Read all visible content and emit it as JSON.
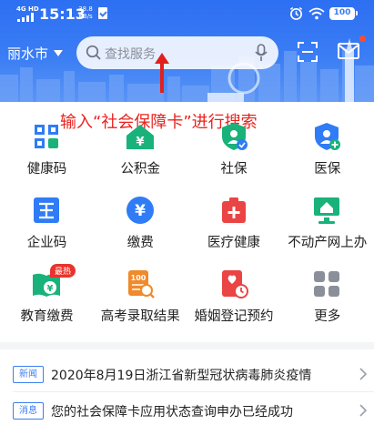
{
  "status_bar": {
    "signal": "4G HD",
    "time": "15:13",
    "net_speed_value": "38.8",
    "net_speed_unit": "KB/s",
    "battery": "100"
  },
  "header": {
    "city": "丽水市",
    "search_placeholder": "查找服务",
    "has_notification_dot": true
  },
  "annotation": "输入“社会保障卡”进行搜索",
  "services": [
    {
      "label": "健康码",
      "icon": "health-code-icon",
      "color": "#2f7cf6"
    },
    {
      "label": "公积金",
      "icon": "housing-fund-icon",
      "color": "#19b27a"
    },
    {
      "label": "社保",
      "icon": "social-security-icon",
      "color": "#19b27a"
    },
    {
      "label": "医保",
      "icon": "medical-insurance-icon",
      "color": "#2f7cf6"
    },
    {
      "label": "企业码",
      "icon": "enterprise-code-icon",
      "color": "#2f7cf6"
    },
    {
      "label": "缴费",
      "icon": "payment-icon",
      "color": "#2f7cf6"
    },
    {
      "label": "医疗健康",
      "icon": "medical-health-icon",
      "color": "#ea4444"
    },
    {
      "label": "不动产网上办",
      "icon": "real-estate-icon",
      "color": "#19b27a"
    },
    {
      "label": "教育缴费",
      "icon": "education-payment-icon",
      "color": "#19b27a",
      "badge": "最热"
    },
    {
      "label": "高考录取结果",
      "icon": "exam-result-icon",
      "color": "#f08a2c"
    },
    {
      "label": "婚姻登记预约",
      "icon": "marriage-registration-icon",
      "color": "#ea4444"
    },
    {
      "label": "更多",
      "icon": "more-grid-icon",
      "color": "#8a8f9a"
    }
  ],
  "news": [
    {
      "tag": "新闻",
      "text": "2020年8月19日浙江省新型冠状病毒肺炎疫情"
    },
    {
      "tag": "消息",
      "text": "您的社会保障卡应用状态查询申办已经成功"
    }
  ]
}
